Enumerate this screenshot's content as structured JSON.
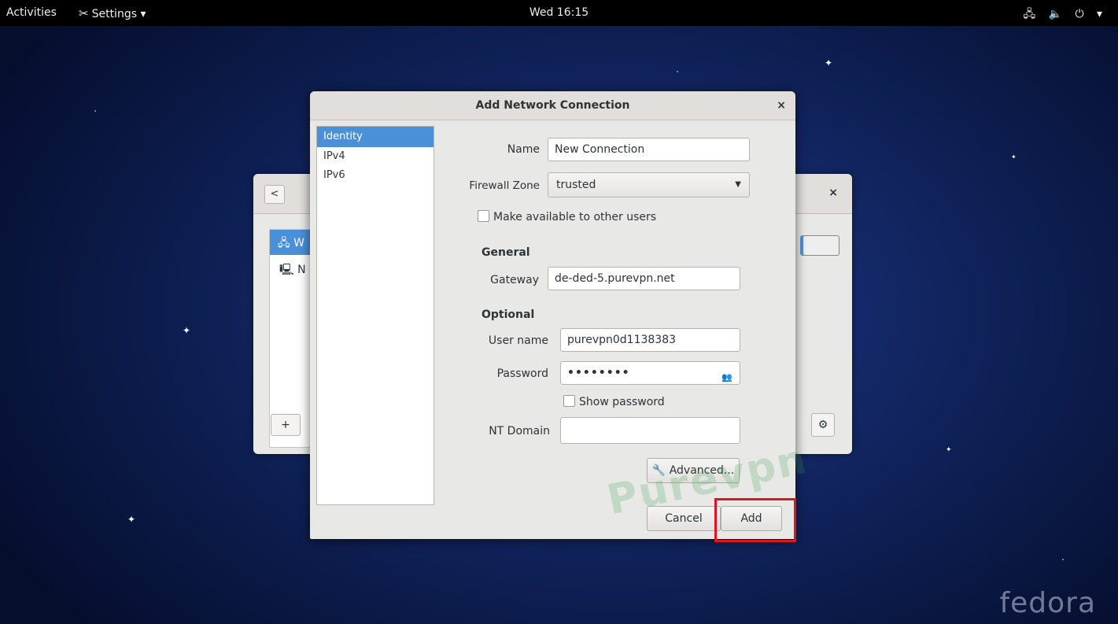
{
  "topbar": {
    "activities": "Activities",
    "app_icon": "tools-icon",
    "app_name": "Settings ▾",
    "clock": "Wed 16:15",
    "tray": "🖧 🔈 ⏻ ▾"
  },
  "background_window": {
    "back_label": "<",
    "close_label": "×",
    "list_items": [
      "W",
      "N"
    ],
    "add_label": "+"
  },
  "dialog": {
    "title": "Add Network Connection",
    "close_label": "×",
    "sidebar": [
      "Identity",
      "IPv4",
      "IPv6"
    ],
    "name_label": "Name",
    "name_value": "New Connection",
    "firewall_label": "Firewall Zone",
    "firewall_value": "trusted",
    "share_label": "Make available to other users",
    "general_header": "General",
    "gateway_label": "Gateway",
    "gateway_value": "de-ded-5.purevpn.net",
    "optional_header": "Optional",
    "username_label": "User name",
    "username_value": "purevpn0d1138383",
    "password_label": "Password",
    "password_value": "••••••••",
    "show_password_label": "Show password",
    "ntdomain_label": "NT Domain",
    "ntdomain_value": "",
    "advanced_label": "Advanced...",
    "cancel_label": "Cancel",
    "add_label": "Add"
  },
  "watermark": "Purevpn",
  "brand": "fedora",
  "colors": {
    "selection": "#4a90d9",
    "highlight": "#e0141c"
  }
}
